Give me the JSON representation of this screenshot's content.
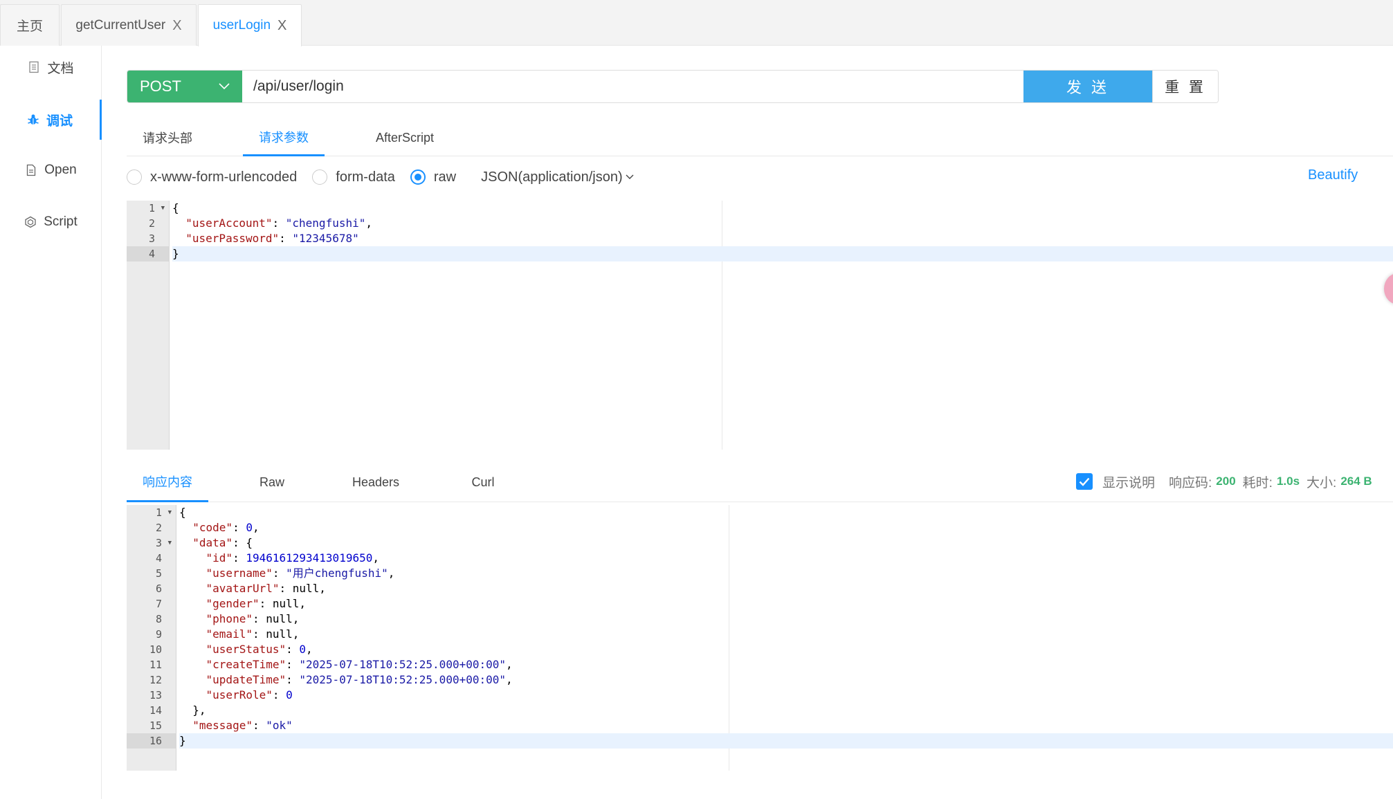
{
  "top_tabs": [
    {
      "label": "主页",
      "closable": false,
      "active": false
    },
    {
      "label": "getCurrentUser",
      "closable": true,
      "active": false
    },
    {
      "label": "userLogin",
      "closable": true,
      "active": true
    }
  ],
  "close_glyph": "X",
  "sidebar": {
    "items": [
      {
        "label": "文档",
        "icon": "document-icon",
        "active": false
      },
      {
        "label": "调试",
        "icon": "bug-icon",
        "active": true
      },
      {
        "label": "Open",
        "icon": "file-icon",
        "active": false
      },
      {
        "label": "Script",
        "icon": "code-icon",
        "active": false
      }
    ]
  },
  "request": {
    "method": "POST",
    "url": "/api/user/login",
    "send_label": "发 送",
    "reset_label": "重 置"
  },
  "request_tabs": [
    "请求头部",
    "请求参数",
    "AfterScript"
  ],
  "active_request_tab": "请求参数",
  "body_types": [
    "x-www-form-urlencoded",
    "form-data",
    "raw"
  ],
  "selected_body_type": "raw",
  "content_type": "JSON(application/json)",
  "beautify_label": "Beautify",
  "request_body_lines": [
    "1",
    "2",
    "3",
    "4"
  ],
  "response_tabs": [
    "响应内容",
    "Raw",
    "Headers",
    "Curl"
  ],
  "active_response_tab": "响应内容",
  "response_meta": {
    "show_desc_label": "显示说明",
    "show_desc_checked": true,
    "status_label": "响应码:",
    "status_value": "200",
    "time_label": "耗时:",
    "time_value": "1.0s",
    "size_label": "大小:",
    "size_value": "264 B"
  },
  "request_body": {
    "userAccount": "chengfushi",
    "userPassword": "12345678"
  },
  "response_body": {
    "code": 0,
    "data": {
      "id": "1946161293413019650",
      "username": "用户chengfushi",
      "avatarUrl": "null",
      "gender": "null",
      "phone": "null",
      "email": "null",
      "userStatus": 0,
      "createTime": "2025-07-18T10:52:25.000+00:00",
      "updateTime": "2025-07-18T10:52:25.000+00:00",
      "userRole": 0
    },
    "message": "ok"
  },
  "colors": {
    "accent": "#1890ff",
    "method_bg": "#3cb371",
    "send_bg": "#3ea9ec",
    "status_ok": "#3cb371"
  }
}
